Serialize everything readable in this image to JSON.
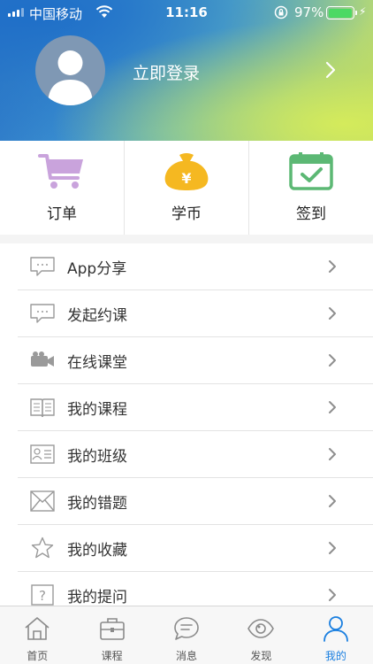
{
  "status_bar": {
    "carrier": "中国移动",
    "time": "11:16",
    "battery_percent": "97%",
    "battery_level": 0.97,
    "battery_color": "#4cd964"
  },
  "profile": {
    "login_label": "立即登录",
    "avatar_icon": "default-user-avatar"
  },
  "quick_actions": [
    {
      "label": "订单",
      "icon": "shopping-cart-icon",
      "color": "#c9a3dc"
    },
    {
      "label": "学币",
      "icon": "money-bag-icon",
      "color": "#f5b821"
    },
    {
      "label": "签到",
      "icon": "calendar-check-icon",
      "color": "#5cb874"
    }
  ],
  "menu": [
    {
      "label": "App分享",
      "icon": "chat-bubble-icon"
    },
    {
      "label": "发起约课",
      "icon": "chat-bubble-icon"
    },
    {
      "label": "在线课堂",
      "icon": "video-camera-icon"
    },
    {
      "label": "我的课程",
      "icon": "open-book-icon"
    },
    {
      "label": "我的班级",
      "icon": "id-card-icon"
    },
    {
      "label": "我的错题",
      "icon": "envelope-icon"
    },
    {
      "label": "我的收藏",
      "icon": "star-icon"
    },
    {
      "label": "我的提问",
      "icon": "question-icon"
    }
  ],
  "tabs": [
    {
      "label": "首页",
      "icon": "home-icon",
      "active": false
    },
    {
      "label": "课程",
      "icon": "briefcase-icon",
      "active": false
    },
    {
      "label": "消息",
      "icon": "message-icon",
      "active": false
    },
    {
      "label": "发现",
      "icon": "eye-icon",
      "active": false
    },
    {
      "label": "我的",
      "icon": "user-icon",
      "active": true
    }
  ],
  "colors": {
    "accent": "#1a7fe0",
    "icon_gray": "#9a9a9a"
  }
}
